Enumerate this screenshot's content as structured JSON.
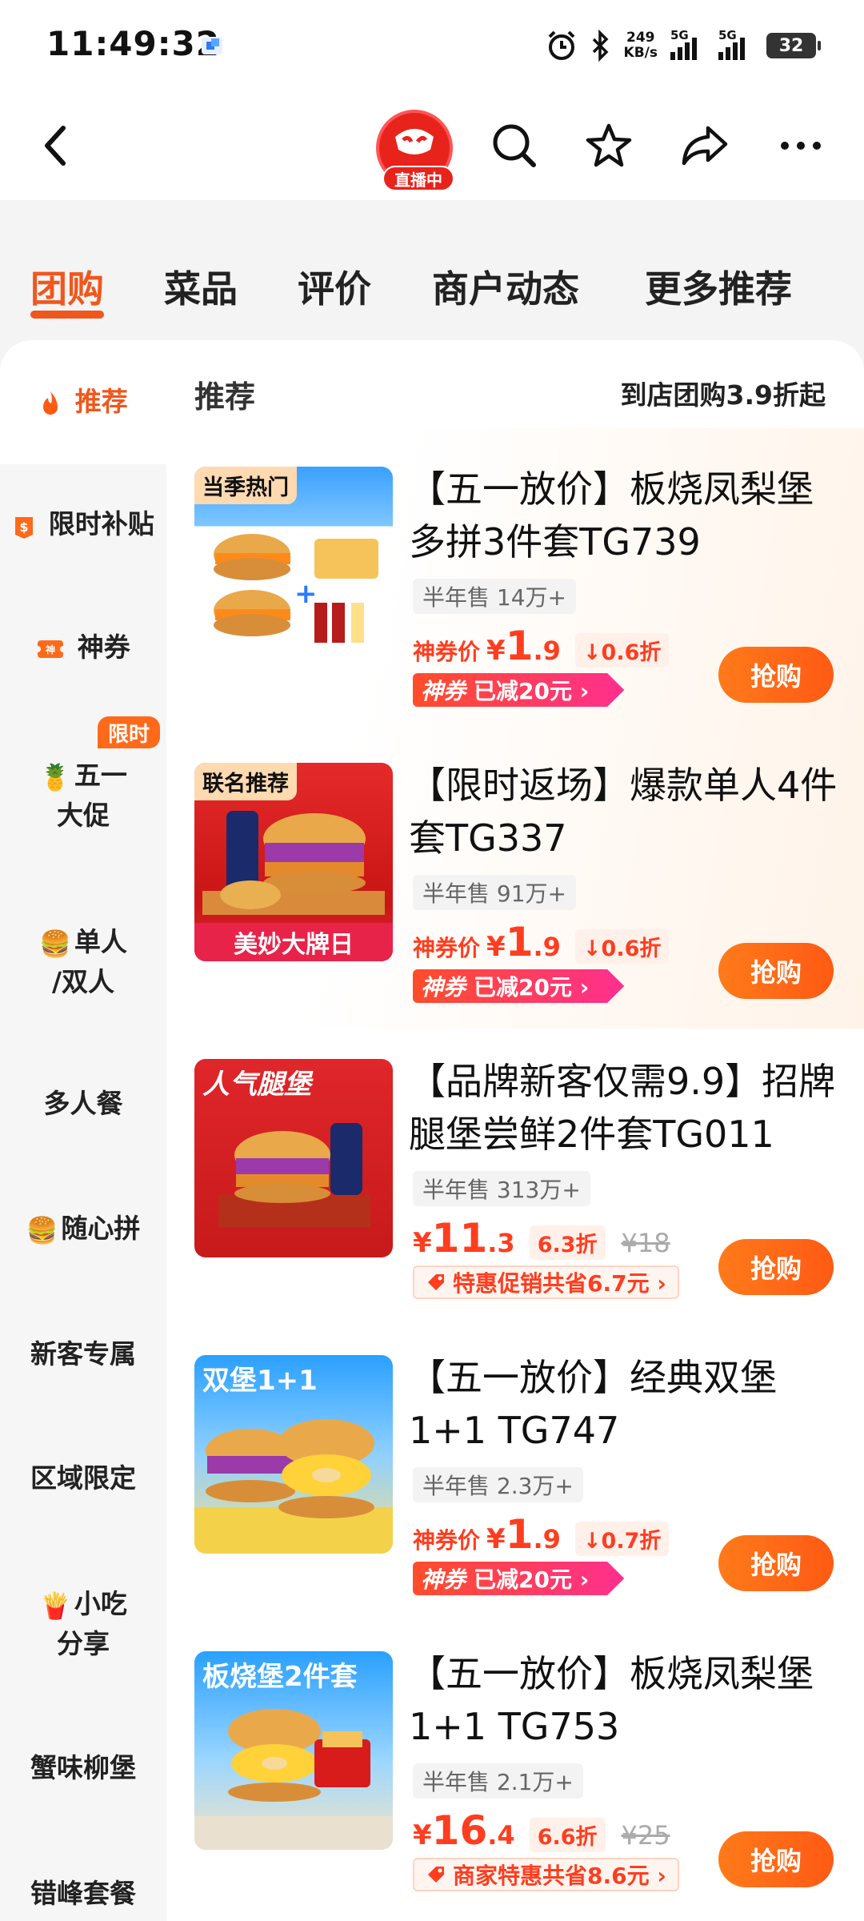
{
  "status": {
    "time": "11:49:32",
    "netspeed_value": "249",
    "netspeed_unit": "KB/s",
    "sig1": "5G",
    "sig2": "5G",
    "battery": "32"
  },
  "nav": {
    "live_label": "直播中"
  },
  "tabs": [
    "团购",
    "菜品",
    "评价",
    "商户动态",
    "更多推荐"
  ],
  "sidebar": {
    "items": [
      {
        "label": "推荐",
        "icon": "fire-icon"
      },
      {
        "label": "限时补贴",
        "icon": "subsidy-icon"
      },
      {
        "label": "神券",
        "icon": "coupon-icon"
      },
      {
        "label": "五一",
        "label2": "大促",
        "icon": "pineapple-icon"
      },
      {
        "label": "单人",
        "label2": "/双人",
        "icon": "burger-icon"
      },
      {
        "label": "多人餐"
      },
      {
        "label": "随心拼",
        "icon": "burger-icon"
      },
      {
        "label": "新客专属"
      },
      {
        "label": "区域限定"
      },
      {
        "label": "小吃",
        "label2": "分享",
        "icon": "fries-icon"
      },
      {
        "label": "蟹味柳堡"
      },
      {
        "label": "错峰套餐"
      }
    ],
    "limited_badge": "限时"
  },
  "main": {
    "heading": "推荐",
    "heading_right": "到店团购3.9折起"
  },
  "cards": [
    {
      "tag": "当季热门",
      "title": "【五一放价】板烧凤梨堡多拼3件套TG739",
      "sold": "半年售 14万+",
      "price_label": "神券价",
      "yen": "¥",
      "int": "1",
      "dec": ".9",
      "disc": "↓0.6折",
      "coupon_tag": "神券",
      "coupon_text": "已减20元 ›",
      "buy": "抢购"
    },
    {
      "tag": "联名推荐",
      "title": "【限时返场】爆款单人4件套TG337",
      "sold": "半年售 91万+",
      "price_label": "神券价",
      "yen": "¥",
      "int": "1",
      "dec": ".9",
      "disc": "↓0.6折",
      "coupon_tag": "神券",
      "coupon_text": "已减20元 ›",
      "buy": "抢购",
      "banner": "美妙大牌日"
    },
    {
      "tag": "人气腿堡",
      "title": "【品牌新客仅需9.9】招牌腿堡尝鲜2件套TG011",
      "sold": "半年售 313万+",
      "yen": "¥",
      "int": "11",
      "dec": ".3",
      "disc": "6.3折",
      "orig": "¥18",
      "promo": "特惠促销共省6.7元 ›",
      "buy": "抢购"
    },
    {
      "tag": "双堡1+1",
      "title": "【五一放价】经典双堡1+1 TG747",
      "sold": "半年售 2.3万+",
      "price_label": "神券价",
      "yen": "¥",
      "int": "1",
      "dec": ".9",
      "disc": "↓0.7折",
      "coupon_tag": "神券",
      "coupon_text": "已减20元 ›",
      "buy": "抢购"
    },
    {
      "tag": "板烧堡2件套",
      "title": "【五一放价】板烧凤梨堡1+1 TG753",
      "sold": "半年售 2.1万+",
      "yen": "¥",
      "int": "16",
      "dec": ".4",
      "disc": "6.6折",
      "orig": "¥25",
      "promo": "商家特惠共省8.6元 ›",
      "buy": "抢购"
    }
  ],
  "colors": {
    "accent": "#f0571d",
    "price": "#ff3d1f"
  }
}
